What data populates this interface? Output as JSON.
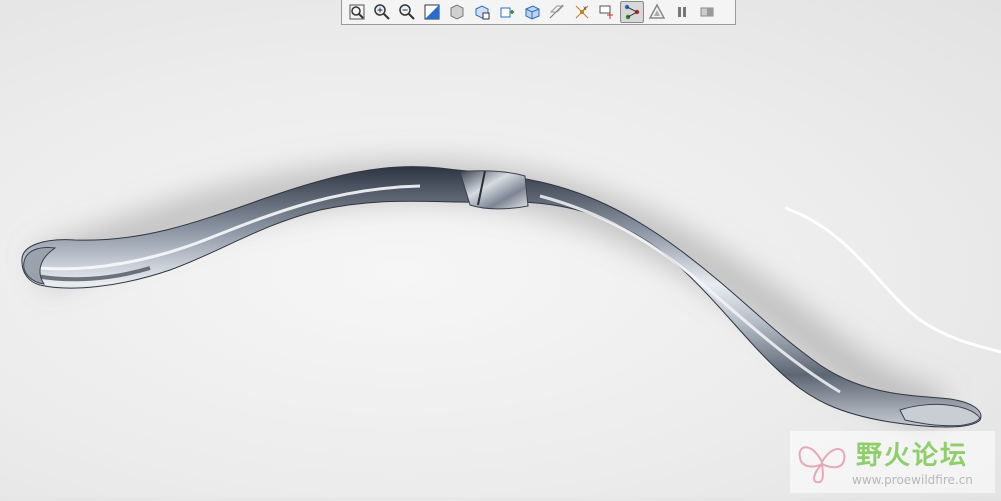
{
  "toolbar": {
    "buttons": [
      {
        "name": "zoom-to-fit-icon",
        "active": false
      },
      {
        "name": "zoom-in-icon",
        "active": false
      },
      {
        "name": "zoom-out-icon",
        "active": false
      },
      {
        "name": "reorient-icon",
        "active": false
      },
      {
        "name": "shaded-display-icon",
        "active": false
      },
      {
        "name": "saved-views-icon",
        "active": false
      },
      {
        "name": "view-manager-icon",
        "active": false
      },
      {
        "name": "perspective-icon",
        "active": false
      },
      {
        "name": "datum-display-icon",
        "active": false
      },
      {
        "name": "point-display-icon",
        "active": false
      },
      {
        "name": "coordinate-system-icon",
        "active": false
      },
      {
        "name": "spin-center-icon",
        "active": true
      },
      {
        "name": "annotation-display-icon",
        "active": false
      },
      {
        "name": "pause-icon",
        "active": false
      },
      {
        "name": "view-tools-icon",
        "active": false
      }
    ],
    "accent_color": "#2a6cc8"
  },
  "watermark": {
    "brand": "野火论坛",
    "url": "www.proewildfire.cn"
  }
}
